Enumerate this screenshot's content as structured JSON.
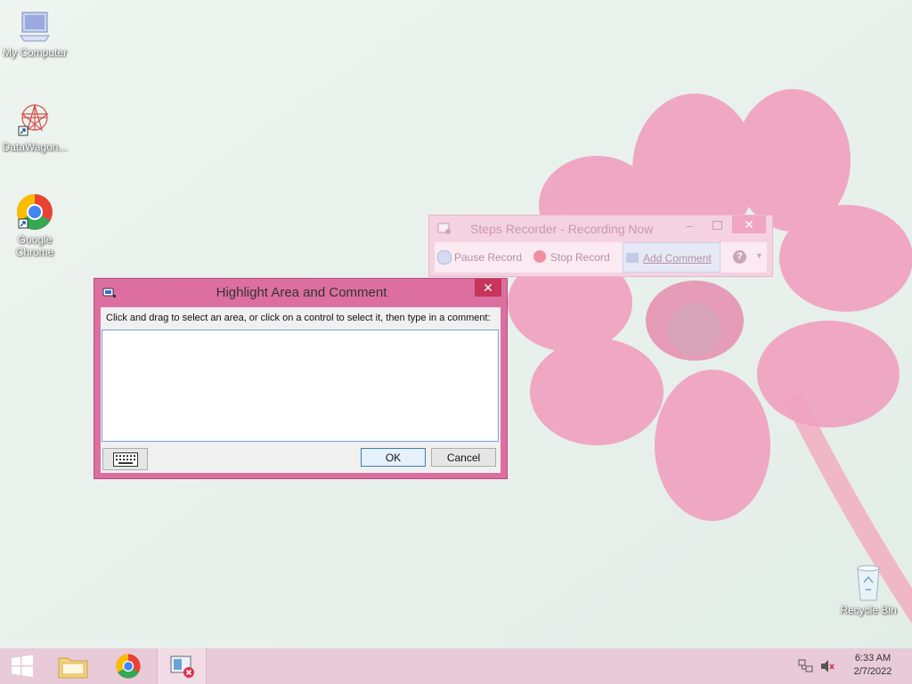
{
  "desktop": {
    "icons": [
      {
        "label": "My Computer"
      },
      {
        "label": "DataWagon..."
      },
      {
        "label": "Google Chrome"
      },
      {
        "label": "Recycle Bin"
      }
    ]
  },
  "steps_recorder": {
    "title": "Steps Recorder - Recording Now",
    "close_glyph": "✕",
    "minimize_glyph": "–",
    "buttons": {
      "pause": "Pause Record",
      "stop": "Stop Record",
      "add_comment": "Add Comment"
    },
    "help_glyph": "?",
    "dropdown_glyph": "▼"
  },
  "dialog": {
    "title": "Highlight Area and Comment",
    "close_glyph": "✕",
    "prompt": "Click and drag to select an area, or click on a control to select it, then type in a comment:",
    "comment_value": "",
    "ok_label": "OK",
    "cancel_label": "Cancel"
  },
  "taskbar": {
    "time": "6:33 AM",
    "date": "2/7/2022"
  },
  "colors": {
    "dialog_frame": "#dc6fa0",
    "taskbar": "#e8cad8",
    "close_button": "#c8355a"
  }
}
